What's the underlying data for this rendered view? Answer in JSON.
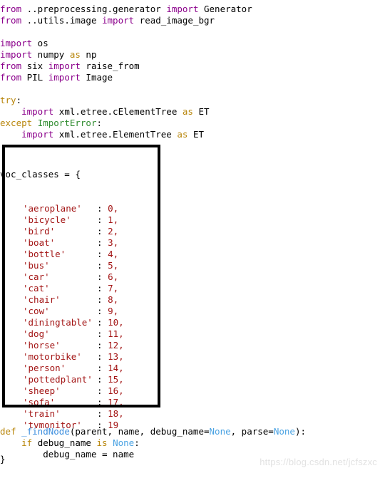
{
  "watermark": "https://blog.csdn.net/jcfszxc",
  "colors": {
    "background": "#ffffff",
    "default_text": "#000000",
    "keyword_import": "#8b008b",
    "keyword_control": "#b8860b",
    "exception_name": "#2e8b2e",
    "function_name": "#3c8ede",
    "constant_none": "#4ba3e3",
    "string_literal": "#a31515",
    "number_literal": "#a31515",
    "highlight_box_border": "#000000",
    "watermark": "#e2e2e2"
  },
  "code": {
    "imports_relative": [
      {
        "kw": "from",
        "module": " ..preprocessing.generator ",
        "kw2": "import",
        "name": " Generator"
      },
      {
        "kw": "from",
        "module": " ..utils.image ",
        "kw2": "import",
        "name": " read_image_bgr"
      }
    ],
    "imports_standard": {
      "line1_kw": "import",
      "line1_name": " os",
      "line2_kw": "import",
      "line2_name": " numpy ",
      "line2_as": "as",
      "line2_alias": " np",
      "line3_kw": "from",
      "line3_module": " six ",
      "line3_kw2": "import",
      "line3_name": " raise_from",
      "line4_kw": "from",
      "line4_module": " PIL ",
      "line4_kw2": "import",
      "line4_name": " Image"
    },
    "try_except": {
      "try_kw": "try",
      "try_colon": ":",
      "try_body_indent": "    ",
      "try_body_kw": "import",
      "try_body_module": " xml.etree.cElementTree ",
      "try_body_as": "as",
      "try_body_alias": " ET",
      "except_kw": "except",
      "except_space": " ",
      "except_exc": "ImportError",
      "except_colon": ":",
      "except_body_indent": "    ",
      "except_body_kw": "import",
      "except_body_module": " xml.etree.ElementTree ",
      "except_body_as": "as",
      "except_body_alias": " ET"
    },
    "voc_dict": {
      "header": "voc_classes = {",
      "closing": "}",
      "entries": [
        {
          "key": "'aeroplane'",
          "value": "0,"
        },
        {
          "key": "'bicycle'",
          "value": "1,"
        },
        {
          "key": "'bird'",
          "value": "2,"
        },
        {
          "key": "'boat'",
          "value": "3,"
        },
        {
          "key": "'bottle'",
          "value": "4,"
        },
        {
          "key": "'bus'",
          "value": "5,"
        },
        {
          "key": "'car'",
          "value": "6,"
        },
        {
          "key": "'cat'",
          "value": "7,"
        },
        {
          "key": "'chair'",
          "value": "8,"
        },
        {
          "key": "'cow'",
          "value": "9,"
        },
        {
          "key": "'diningtable'",
          "value": "10,"
        },
        {
          "key": "'dog'",
          "value": "11,"
        },
        {
          "key": "'horse'",
          "value": "12,"
        },
        {
          "key": "'motorbike'",
          "value": "13,"
        },
        {
          "key": "'person'",
          "value": "14,"
        },
        {
          "key": "'pottedplant'",
          "value": "15,"
        },
        {
          "key": "'sheep'",
          "value": "16,"
        },
        {
          "key": "'sofa'",
          "value": "17,"
        },
        {
          "key": "'train'",
          "value": "18,"
        },
        {
          "key": "'tvmonitor'",
          "value": "19"
        }
      ],
      "colon": ":"
    },
    "find_node": {
      "def_kw": "def",
      "def_space": " ",
      "fn_name": "_findNode",
      "args_open": "(parent, name, debug_name=",
      "none1": "None",
      "args_mid": ", parse=",
      "none2": "None",
      "args_close": "):",
      "if_indent": "    ",
      "if_kw": "if",
      "if_var": " debug_name ",
      "if_is": "is",
      "if_space": " ",
      "if_none": "None",
      "if_colon": ":",
      "body_indent": "        ",
      "body_text": "debug_name = name"
    }
  }
}
